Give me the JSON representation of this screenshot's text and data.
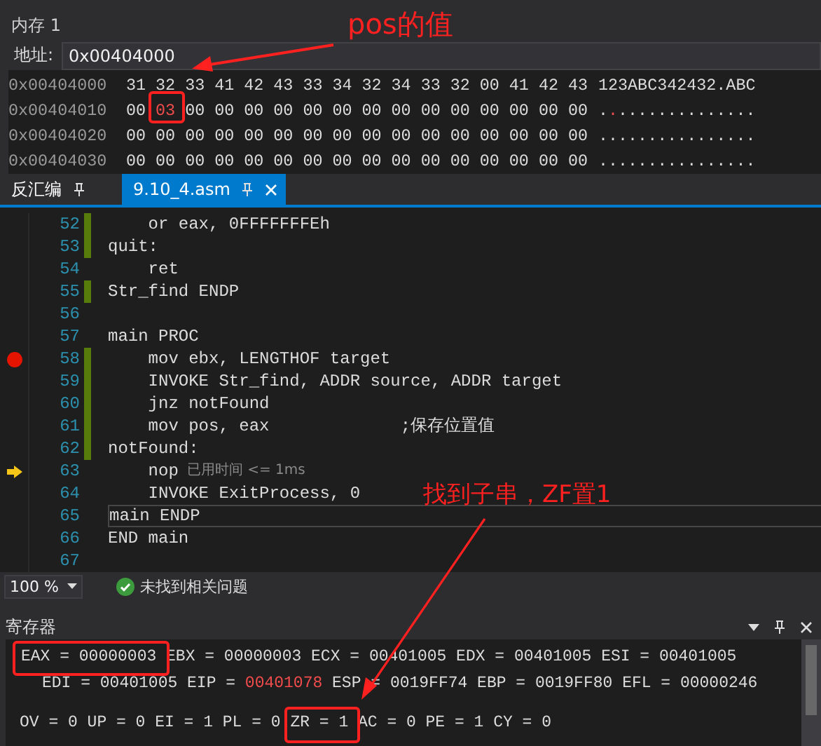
{
  "memory": {
    "title": "内存 1",
    "address_label": "地址:",
    "address": "0x00404000",
    "rows": [
      {
        "address": "0x00404000",
        "bytes": [
          {
            "text": "31",
            "changed": false
          },
          {
            "text": "32",
            "changed": false
          },
          {
            "text": "33",
            "changed": false
          },
          {
            "text": "41",
            "changed": false
          },
          {
            "text": "42",
            "changed": false
          },
          {
            "text": "43",
            "changed": false
          },
          {
            "text": "33",
            "changed": false
          },
          {
            "text": "34",
            "changed": false
          },
          {
            "text": "32",
            "changed": false
          },
          {
            "text": "34",
            "changed": false
          },
          {
            "text": "33",
            "changed": false
          },
          {
            "text": "32",
            "changed": false
          },
          {
            "text": "00",
            "changed": false
          },
          {
            "text": "41",
            "changed": false
          },
          {
            "text": "42",
            "changed": false
          },
          {
            "text": "43",
            "changed": false
          }
        ],
        "ascii": [
          {
            "text": "123ABC342432.ABC",
            "changed": false
          }
        ]
      },
      {
        "address": "0x00404010",
        "bytes": [
          {
            "text": "00",
            "changed": false
          },
          {
            "text": "03",
            "changed": true
          },
          {
            "text": "00",
            "changed": false
          },
          {
            "text": "00",
            "changed": false
          },
          {
            "text": "00",
            "changed": false
          },
          {
            "text": "00",
            "changed": false
          },
          {
            "text": "00",
            "changed": false
          },
          {
            "text": "00",
            "changed": false
          },
          {
            "text": "00",
            "changed": false
          },
          {
            "text": "00",
            "changed": false
          },
          {
            "text": "00",
            "changed": false
          },
          {
            "text": "00",
            "changed": false
          },
          {
            "text": "00",
            "changed": false
          },
          {
            "text": "00",
            "changed": false
          },
          {
            "text": "00",
            "changed": false
          },
          {
            "text": "00",
            "changed": false
          }
        ],
        "ascii": [
          {
            "text": ".",
            "changed": false
          },
          {
            "text": ".",
            "changed": true
          },
          {
            "text": "..............",
            "changed": false
          }
        ]
      },
      {
        "address": "0x00404020",
        "bytes": [
          {
            "text": "00",
            "changed": false
          },
          {
            "text": "00",
            "changed": false
          },
          {
            "text": "00",
            "changed": false
          },
          {
            "text": "00",
            "changed": false
          },
          {
            "text": "00",
            "changed": false
          },
          {
            "text": "00",
            "changed": false
          },
          {
            "text": "00",
            "changed": false
          },
          {
            "text": "00",
            "changed": false
          },
          {
            "text": "00",
            "changed": false
          },
          {
            "text": "00",
            "changed": false
          },
          {
            "text": "00",
            "changed": false
          },
          {
            "text": "00",
            "changed": false
          },
          {
            "text": "00",
            "changed": false
          },
          {
            "text": "00",
            "changed": false
          },
          {
            "text": "00",
            "changed": false
          },
          {
            "text": "00",
            "changed": false
          }
        ],
        "ascii": [
          {
            "text": "................",
            "changed": false
          }
        ]
      },
      {
        "address": "0x00404030",
        "bytes": [
          {
            "text": "00",
            "changed": false
          },
          {
            "text": "00",
            "changed": false
          },
          {
            "text": "00",
            "changed": false
          },
          {
            "text": "00",
            "changed": false
          },
          {
            "text": "00",
            "changed": false
          },
          {
            "text": "00",
            "changed": false
          },
          {
            "text": "00",
            "changed": false
          },
          {
            "text": "00",
            "changed": false
          },
          {
            "text": "00",
            "changed": false
          },
          {
            "text": "00",
            "changed": false
          },
          {
            "text": "00",
            "changed": false
          },
          {
            "text": "00",
            "changed": false
          },
          {
            "text": "00",
            "changed": false
          },
          {
            "text": "00",
            "changed": false
          },
          {
            "text": "00",
            "changed": false
          },
          {
            "text": "00",
            "changed": false
          }
        ],
        "ascii": [
          {
            "text": "................",
            "changed": false
          }
        ]
      }
    ]
  },
  "tabs": [
    {
      "label": "反汇编",
      "selected": false,
      "closable": false
    },
    {
      "label": "9.10_4.asm",
      "selected": true,
      "closable": true
    }
  ],
  "editor": {
    "lines": [
      {
        "number": "52",
        "text": "    or eax, 0FFFFFFFEh",
        "changed": true,
        "breakpoint": false,
        "current": false,
        "focused": false
      },
      {
        "number": "53",
        "text": "quit:",
        "changed": true,
        "breakpoint": false,
        "current": false,
        "focused": false
      },
      {
        "number": "54",
        "text": "    ret",
        "changed": false,
        "breakpoint": false,
        "current": false,
        "focused": false
      },
      {
        "number": "55",
        "text": "Str_find ENDP",
        "changed": true,
        "breakpoint": false,
        "current": false,
        "focused": false
      },
      {
        "number": "56",
        "changed": false,
        "breakpoint": false,
        "current": false,
        "focused": false
      },
      {
        "number": "57",
        "text": "main PROC",
        "changed": false,
        "breakpoint": false,
        "current": false,
        "focused": false
      },
      {
        "number": "58",
        "text": "    mov ebx, LENGTHOF target",
        "changed": true,
        "breakpoint": true,
        "current": false,
        "focused": false
      },
      {
        "number": "59",
        "text": "    INVOKE Str_find, ADDR source, ADDR target",
        "changed": true,
        "breakpoint": false,
        "current": false,
        "focused": false
      },
      {
        "number": "60",
        "text": "    jnz notFound",
        "changed": true,
        "breakpoint": false,
        "current": false,
        "focused": false
      },
      {
        "number": "61",
        "text": "    mov pos, eax             ;保存位置值",
        "changed": true,
        "breakpoint": false,
        "current": false,
        "focused": false
      },
      {
        "number": "62",
        "text": "notFound:",
        "changed": true,
        "breakpoint": false,
        "current": false,
        "focused": false
      },
      {
        "number": "63",
        "text": "    nop",
        "hint": "已用时间 <= 1ms",
        "changed": false,
        "breakpoint": false,
        "current": true,
        "focused": false
      },
      {
        "number": "64",
        "text": "    INVOKE ExitProcess, 0",
        "changed": false,
        "breakpoint": false,
        "current": false,
        "focused": false
      },
      {
        "number": "65",
        "text": "main ENDP",
        "changed": false,
        "breakpoint": false,
        "current": false,
        "focused": true
      },
      {
        "number": "66",
        "text": "END main",
        "changed": false,
        "breakpoint": false,
        "current": false,
        "focused": false
      },
      {
        "number": "67",
        "changed": false,
        "breakpoint": false,
        "current": false,
        "focused": false
      }
    ]
  },
  "status_bar": {
    "zoom": "100 %",
    "message": "未找到相关问题"
  },
  "registers": {
    "title": "寄存器",
    "lines": [
      {
        "kind": "general",
        "items": [
          {
            "label": "EAX =",
            "value": "00000003",
            "changed": false
          },
          {
            "label": "EBX =",
            "value": "00000003",
            "changed": false
          },
          {
            "label": "ECX =",
            "value": "00401005",
            "changed": false
          },
          {
            "label": "EDX =",
            "value": "00401005",
            "changed": false
          },
          {
            "label": "ESI =",
            "value": "00401005",
            "changed": false
          }
        ]
      },
      {
        "kind": "continued",
        "items": [
          {
            "label": "EDI =",
            "value": "00401005",
            "changed": false
          },
          {
            "label": "EIP =",
            "value": "00401078",
            "changed": true
          },
          {
            "label": "ESP =",
            "value": "0019FF74",
            "changed": false
          },
          {
            "label": "EBP =",
            "value": "0019FF80",
            "changed": false
          },
          {
            "label": "EFL =",
            "value": "00000246",
            "changed": false
          }
        ]
      },
      {
        "kind": "flags",
        "items": [
          {
            "label": "OV =",
            "value": "0",
            "changed": false
          },
          {
            "label": "UP =",
            "value": "0",
            "changed": false
          },
          {
            "label": "EI =",
            "value": "1",
            "changed": false
          },
          {
            "label": "PL =",
            "value": "0",
            "changed": false
          },
          {
            "label": "ZR =",
            "value": "1",
            "changed": false
          },
          {
            "label": "AC =",
            "value": "0",
            "changed": false
          },
          {
            "label": "PE =",
            "value": "1",
            "changed": false
          },
          {
            "label": "CY =",
            "value": "0",
            "changed": false
          }
        ]
      }
    ]
  },
  "annotations": [
    {
      "text": "pos的值"
    },
    {
      "text": "找到子串，ZF置1"
    }
  ]
}
